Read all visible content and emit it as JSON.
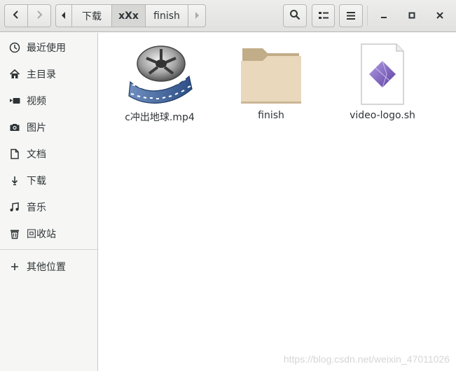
{
  "header": {
    "path_segments": [
      {
        "label": "下载",
        "state": "normal"
      },
      {
        "label": "xXx",
        "state": "active"
      },
      {
        "label": "finish",
        "state": "normal"
      }
    ],
    "icons": {
      "back": "go-back-icon",
      "forward": "go-forward-icon",
      "path_left": "path-scroll-left-icon",
      "path_right": "path-scroll-right-icon",
      "search": "search-icon",
      "view": "view-options-icon",
      "menu": "menu-icon",
      "minimize": "minimize-icon",
      "maximize": "maximize-icon",
      "close": "close-icon"
    }
  },
  "sidebar": {
    "items": [
      {
        "label": "最近使用",
        "icon": "recent-icon"
      },
      {
        "label": "主目录",
        "icon": "home-icon"
      },
      {
        "label": "视频",
        "icon": "videos-icon"
      },
      {
        "label": "图片",
        "icon": "pictures-icon"
      },
      {
        "label": "文档",
        "icon": "documents-icon"
      },
      {
        "label": "下载",
        "icon": "downloads-icon"
      },
      {
        "label": "音乐",
        "icon": "music-icon"
      },
      {
        "label": "回收站",
        "icon": "trash-icon"
      }
    ],
    "other_locations": {
      "label": "其他位置",
      "icon": "plus-icon"
    }
  },
  "files": [
    {
      "name": "c冲出地球.mp4",
      "icon": "video-file-icon"
    },
    {
      "name": "finish",
      "icon": "folder-icon"
    },
    {
      "name": "video-logo.sh",
      "icon": "script-file-icon"
    }
  ],
  "watermark": "https://blog.csdn.net/weixin_47011026",
  "colors": {
    "folder": "#d9c6a5",
    "folder_tab": "#c2ad89",
    "sidebar_bg": "#f6f6f5",
    "header_bg": "#e8e8e7"
  }
}
